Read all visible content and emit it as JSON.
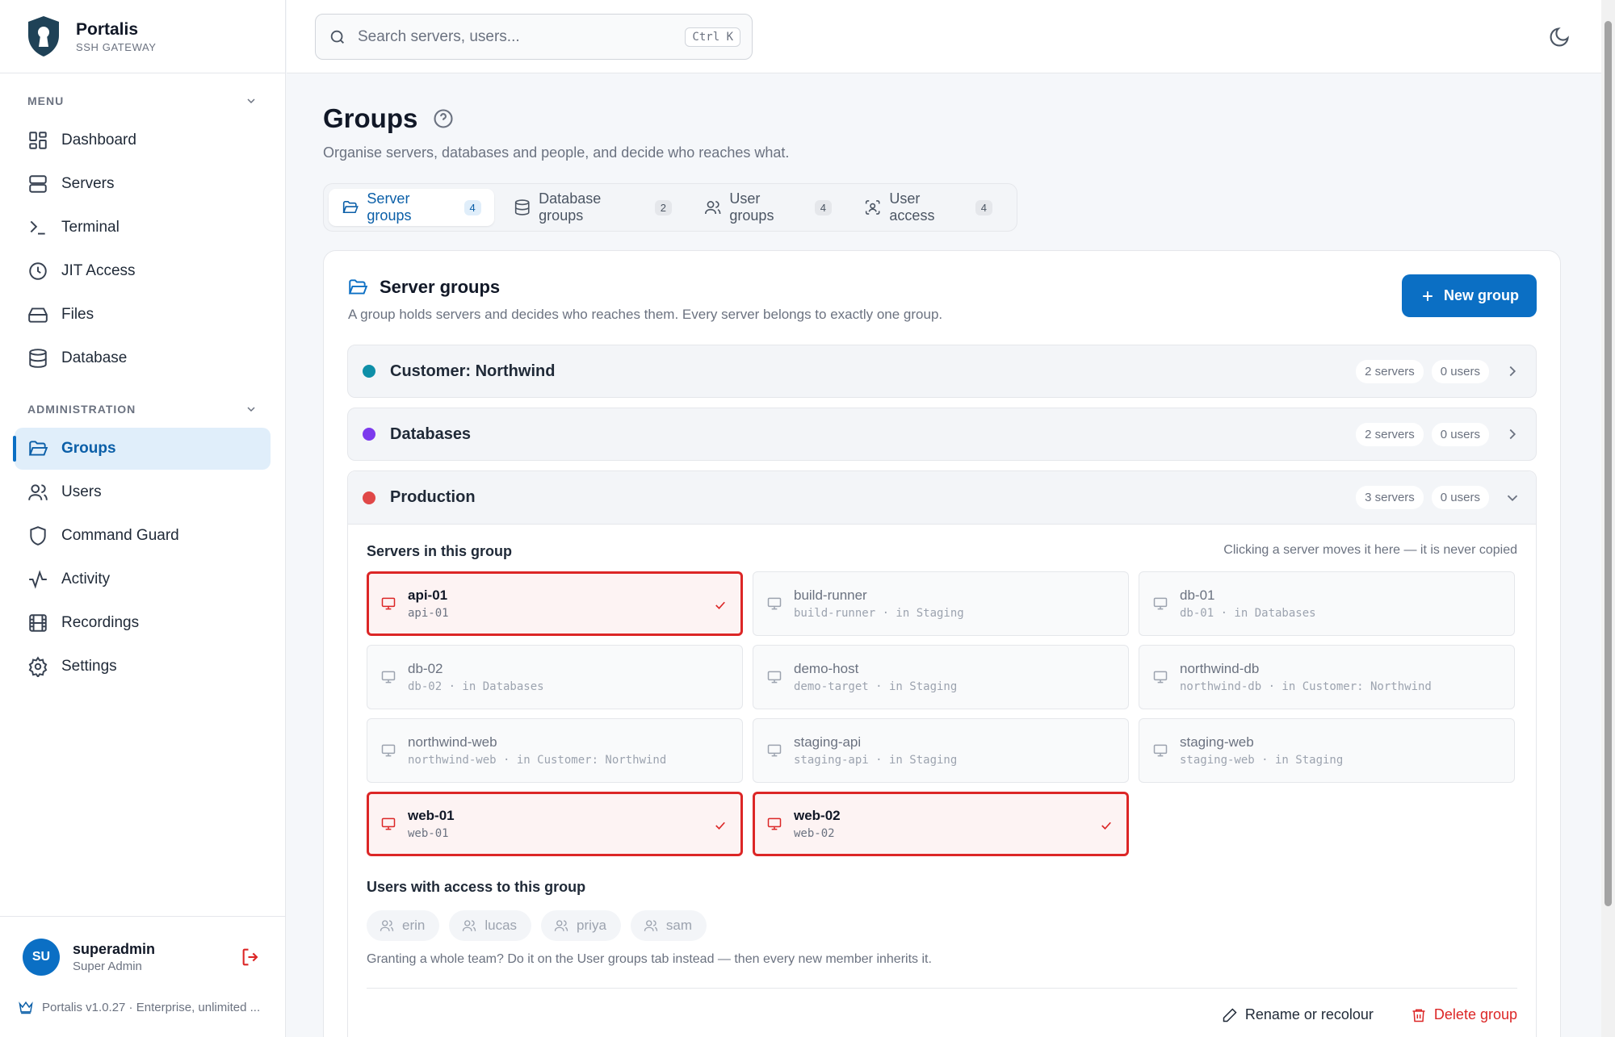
{
  "brand": {
    "name": "Portalis",
    "subtitle": "SSH GATEWAY"
  },
  "sidebar": {
    "menu_label": "MENU",
    "menu_items": [
      {
        "label": "Dashboard",
        "icon": "dashboard-icon"
      },
      {
        "label": "Servers",
        "icon": "server-icon"
      },
      {
        "label": "Terminal",
        "icon": "terminal-icon"
      },
      {
        "label": "JIT Access",
        "icon": "clock-icon"
      },
      {
        "label": "Files",
        "icon": "drive-icon"
      },
      {
        "label": "Database",
        "icon": "database-icon"
      }
    ],
    "admin_label": "ADMINISTRATION",
    "admin_items": [
      {
        "label": "Groups",
        "icon": "folder-open-icon",
        "active": true
      },
      {
        "label": "Users",
        "icon": "users-icon"
      },
      {
        "label": "Command Guard",
        "icon": "shield-icon"
      },
      {
        "label": "Activity",
        "icon": "activity-icon"
      },
      {
        "label": "Recordings",
        "icon": "film-icon"
      },
      {
        "label": "Settings",
        "icon": "gear-icon"
      }
    ],
    "user": {
      "initials": "SU",
      "name": "superadmin",
      "role": "Super Admin"
    },
    "version": "Portalis v1.0.27 · Enterprise, unlimited ..."
  },
  "topbar": {
    "search_placeholder": "Search servers, users...",
    "shortcut": "Ctrl K"
  },
  "page": {
    "title": "Groups",
    "subtitle": "Organise servers, databases and people, and decide who reaches what.",
    "tabs": [
      {
        "label": "Server groups",
        "count": "4",
        "icon": "folder-open-icon",
        "active": true
      },
      {
        "label": "Database groups",
        "count": "2",
        "icon": "database-icon"
      },
      {
        "label": "User groups",
        "count": "4",
        "icon": "users-icon"
      },
      {
        "label": "User access",
        "count": "4",
        "icon": "scan-user-icon"
      }
    ]
  },
  "panel": {
    "title": "Server groups",
    "subtitle": "A group holds servers and decides who reaches them. Every server belongs to exactly one group.",
    "new_button": "New group",
    "groups": [
      {
        "name": "Customer: Northwind",
        "servers": "2 servers",
        "users": "0 users",
        "color": "#0e8fa8"
      },
      {
        "name": "Databases",
        "servers": "2 servers",
        "users": "0 users",
        "color": "#7c3aed"
      },
      {
        "name": "Production",
        "servers": "3 servers",
        "users": "0 users",
        "color": "#e04848"
      }
    ],
    "expanded": {
      "servers_label": "Servers in this group",
      "hint": "Clicking a server moves it here — it is never copied",
      "servers": [
        {
          "name": "api-01",
          "host": "api-01",
          "selected": true
        },
        {
          "name": "build-runner",
          "host": "build-runner · in Staging"
        },
        {
          "name": "db-01",
          "host": "db-01 · in Databases"
        },
        {
          "name": "db-02",
          "host": "db-02 · in Databases"
        },
        {
          "name": "demo-host",
          "host": "demo-target · in Staging"
        },
        {
          "name": "northwind-db",
          "host": "northwind-db · in Customer: Northwind"
        },
        {
          "name": "northwind-web",
          "host": "northwind-web · in Customer: Northwind"
        },
        {
          "name": "staging-api",
          "host": "staging-api · in Staging"
        },
        {
          "name": "staging-web",
          "host": "staging-web · in Staging"
        },
        {
          "name": "web-01",
          "host": "web-01",
          "selected": true
        },
        {
          "name": "web-02",
          "host": "web-02",
          "selected": true
        }
      ],
      "users_label": "Users with access to this group",
      "users": [
        "erin",
        "lucas",
        "priya",
        "sam"
      ],
      "note": "Granting a whole team? Do it on the User groups tab instead — then every new member inherits it.",
      "rename_label": "Rename or recolour",
      "delete_label": "Delete group"
    }
  }
}
